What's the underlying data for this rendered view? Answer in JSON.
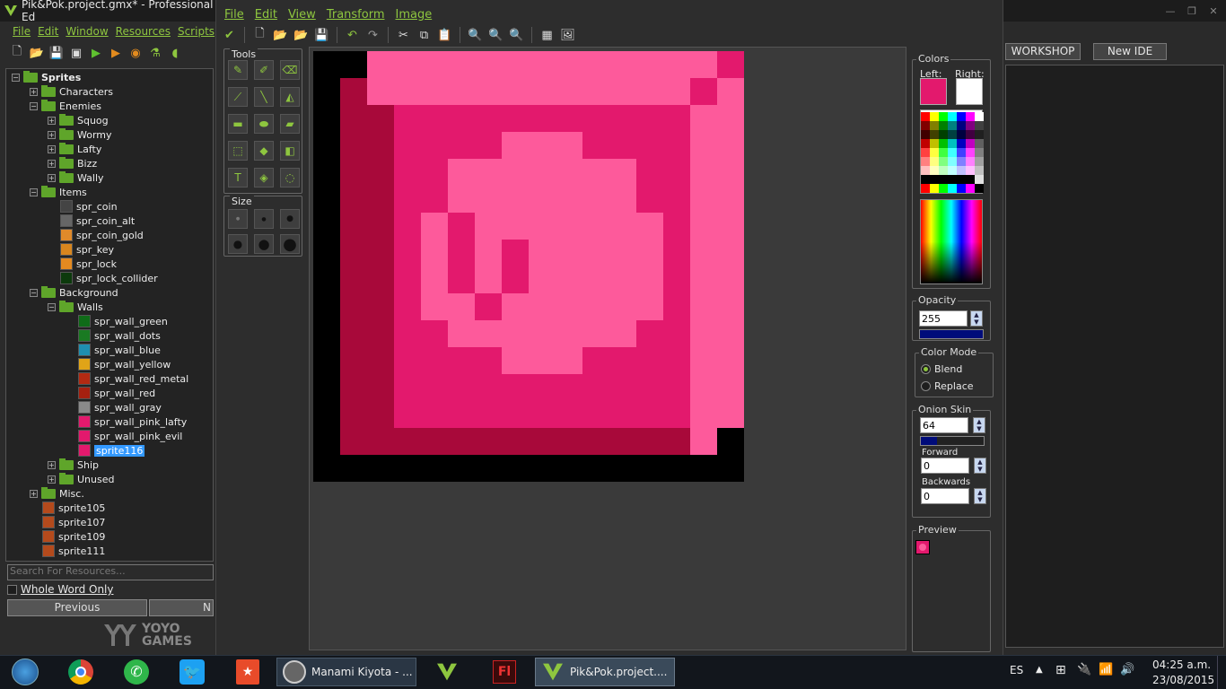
{
  "ide": {
    "title": "Pik&Pok.project.gmx*  -  Professional Ed",
    "menu": [
      "File",
      "Edit",
      "Window",
      "Resources",
      "Scripts"
    ],
    "search_placeholder": "Search For Resources...",
    "whole_word_label": "Whole Word Only",
    "prev_label": "Previous",
    "next_label": "N",
    "brand_line1": "YOYO",
    "brand_line2": "GAMES"
  },
  "tree": [
    {
      "label": "Sprites",
      "level": 0,
      "kind": "folder",
      "expander": "−",
      "bold": true
    },
    {
      "label": "Characters",
      "level": 1,
      "kind": "folder",
      "expander": "+"
    },
    {
      "label": "Enemies",
      "level": 1,
      "kind": "folder",
      "expander": "−"
    },
    {
      "label": "Squog",
      "level": 2,
      "kind": "folder",
      "expander": "+"
    },
    {
      "label": "Wormy",
      "level": 2,
      "kind": "folder",
      "expander": "+"
    },
    {
      "label": "Lafty",
      "level": 2,
      "kind": "folder",
      "expander": "+"
    },
    {
      "label": "Bizz",
      "level": 2,
      "kind": "folder",
      "expander": "+"
    },
    {
      "label": "Wally",
      "level": 2,
      "kind": "folder",
      "expander": "+"
    },
    {
      "label": "Items",
      "level": 1,
      "kind": "folder",
      "expander": "−"
    },
    {
      "label": "spr_coin",
      "level": 2,
      "kind": "sprite",
      "color": "#444444"
    },
    {
      "label": "spr_coin_alt",
      "level": 2,
      "kind": "sprite",
      "color": "#666666"
    },
    {
      "label": "spr_coin_gold",
      "level": 2,
      "kind": "sprite",
      "color": "#e08a2a"
    },
    {
      "label": "spr_key",
      "level": 2,
      "kind": "sprite",
      "color": "#d8861e"
    },
    {
      "label": "spr_lock",
      "level": 2,
      "kind": "sprite",
      "color": "#e38a20"
    },
    {
      "label": "spr_lock_collider",
      "level": 2,
      "kind": "sprite",
      "color": "#0c3a0c"
    },
    {
      "label": "Background",
      "level": 1,
      "kind": "folder",
      "expander": "−"
    },
    {
      "label": "Walls",
      "level": 2,
      "kind": "folder",
      "expander": "−"
    },
    {
      "label": "spr_wall_green",
      "level": 3,
      "kind": "sprite",
      "color": "#0f6b18"
    },
    {
      "label": "spr_wall_dots",
      "level": 3,
      "kind": "sprite",
      "color": "#1a7a22"
    },
    {
      "label": "spr_wall_blue",
      "level": 3,
      "kind": "sprite",
      "color": "#1f8fb0"
    },
    {
      "label": "spr_wall_yellow",
      "level": 3,
      "kind": "sprite",
      "color": "#e0a418"
    },
    {
      "label": "spr_wall_red_metal",
      "level": 3,
      "kind": "sprite",
      "color": "#b32a12"
    },
    {
      "label": "spr_wall_red",
      "level": 3,
      "kind": "sprite",
      "color": "#a52010"
    },
    {
      "label": "spr_wall_gray",
      "level": 3,
      "kind": "sprite",
      "color": "#8a8a8a"
    },
    {
      "label": "spr_wall_pink_lafty",
      "level": 3,
      "kind": "sprite",
      "color": "#e3196d"
    },
    {
      "label": "spr_wall_pink_evil",
      "level": 3,
      "kind": "sprite",
      "color": "#e3196d"
    },
    {
      "label": "sprite116",
      "level": 3,
      "kind": "sprite",
      "color": "#e3196d",
      "selected": true
    },
    {
      "label": "Ship",
      "level": 2,
      "kind": "folder",
      "expander": "+"
    },
    {
      "label": "Unused",
      "level": 2,
      "kind": "folder",
      "expander": "+"
    },
    {
      "label": "Misc.",
      "level": 1,
      "kind": "folder",
      "expander": "+"
    },
    {
      "label": "sprite105",
      "level": 1,
      "kind": "sprite",
      "color": "#b44a1c"
    },
    {
      "label": "sprite107",
      "level": 1,
      "kind": "sprite",
      "color": "#b44a1c"
    },
    {
      "label": "sprite109",
      "level": 1,
      "kind": "sprite",
      "color": "#b44a1c"
    },
    {
      "label": "sprite111",
      "level": 1,
      "kind": "sprite",
      "color": "#b44a1c"
    }
  ],
  "editor": {
    "menu": [
      "File",
      "Edit",
      "View",
      "Transform",
      "Image"
    ],
    "tools_label": "Tools",
    "size_label": "Size",
    "colors_label": "Colors",
    "left_label": "Left:",
    "right_label": "Right:",
    "left_color": "#e3196d",
    "right_color": "#ffffff",
    "opacity_label": "Opacity",
    "opacity_value": "255",
    "opacity_fraction": 1.0,
    "color_mode_label": "Color Mode",
    "blend_label": "Blend",
    "replace_label": "Replace",
    "onion_label": "Onion Skin",
    "onion_value": "64",
    "onion_fraction": 0.25,
    "forward_label": "Forward",
    "forward_value": "0",
    "backwards_label": "Backwards",
    "backwards_value": "0",
    "preview_label": "Preview"
  },
  "workshop": {
    "label": "WORKSHOP",
    "newide_label": "New IDE"
  },
  "taskbar": {
    "items": [
      {
        "label": "",
        "icon": "start-orb-icon"
      },
      {
        "label": "",
        "icon": "chrome-icon"
      },
      {
        "label": "",
        "icon": "whatsapp-icon"
      },
      {
        "label": "",
        "icon": "twitter-icon"
      },
      {
        "label": "",
        "icon": "bookmark-icon"
      },
      {
        "label": "Manami Kiyota - ...",
        "icon": "media-icon"
      },
      {
        "label": "",
        "icon": "gamemaker-icon"
      },
      {
        "label": "",
        "icon": "flash-icon"
      },
      {
        "label": "Pik&Pok.project....",
        "icon": "gamemaker-icon"
      }
    ],
    "lang": "ES",
    "time": "04:25 a.m.",
    "date": "23/08/2015"
  }
}
